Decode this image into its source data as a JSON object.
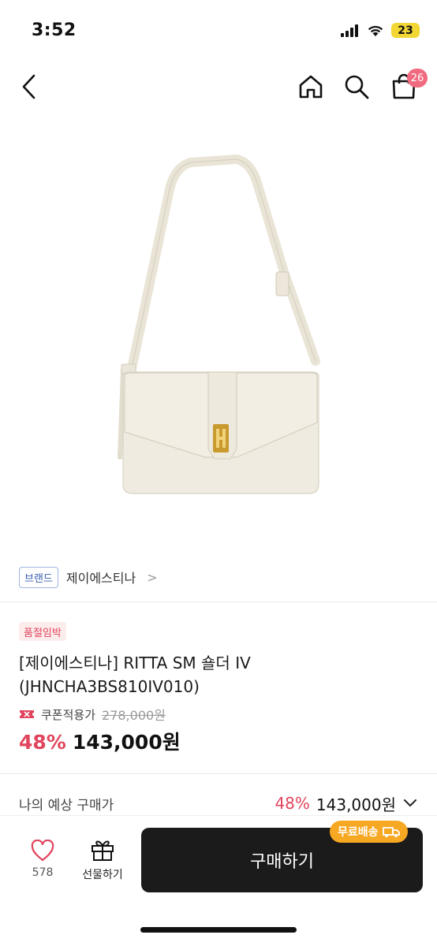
{
  "status_bar": {
    "time": "3:52",
    "battery": "23"
  },
  "nav": {
    "cart_count": "26"
  },
  "brand": {
    "tag": "브랜드",
    "name": "제이에스티나",
    "chevron": ">"
  },
  "product": {
    "stock_badge": "품절임박",
    "title": "[제이에스티나] RITTA SM 숄더 IV (JHNCHA3BS810IV010)",
    "coupon_label": "쿠폰적용가",
    "original_price": "278,000원",
    "discount": "48%",
    "price": "143,000원"
  },
  "expected": {
    "label": "나의 예상 구매가",
    "discount": "48%",
    "price": "143,000원"
  },
  "bottom_bar": {
    "like_count": "578",
    "gift_label": "선물하기",
    "buy_label": "구매하기",
    "free_shipping_label": "무료배송"
  },
  "colors": {
    "accent": "#e0455d",
    "buy_button": "#1b1b1b",
    "free_shipping": "#f7a823",
    "battery": "#f2d633"
  }
}
